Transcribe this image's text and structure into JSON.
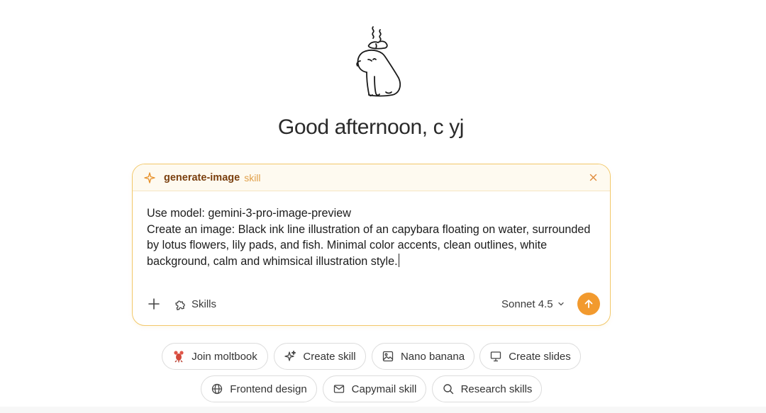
{
  "greeting": "Good afternoon, c yj",
  "skill": {
    "name": "generate-image",
    "tag": "skill"
  },
  "prompt": {
    "line1": "Use model: gemini-3-pro-image-preview",
    "line2": "Create an image: Black ink line illustration of an capybara floating on water, surrounded by lotus flowers, lily pads, and fish. Minimal color accents, clean outlines, white background, calm and whimsical illustration style."
  },
  "toolbar": {
    "skills_label": "Skills",
    "model_label": "Sonnet 4.5"
  },
  "chips": [
    {
      "label": "Join moltbook",
      "icon": "lobster-icon"
    },
    {
      "label": "Create skill",
      "icon": "sparkle-icon"
    },
    {
      "label": "Nano banana",
      "icon": "image-icon"
    },
    {
      "label": "Create slides",
      "icon": "presentation-icon"
    },
    {
      "label": "Frontend design",
      "icon": "globe-icon"
    },
    {
      "label": "Capymail skill",
      "icon": "mail-icon"
    },
    {
      "label": "Research skills",
      "icon": "search-icon"
    }
  ],
  "colors": {
    "accent": "#f29a2e",
    "border": "#f2c86b",
    "skill_text": "#7a3f0e",
    "skill_tag": "#e1a04a"
  }
}
